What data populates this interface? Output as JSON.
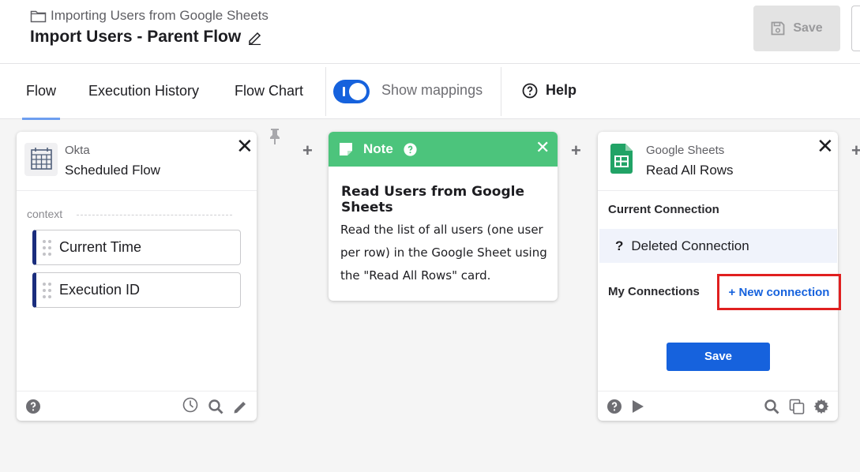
{
  "header": {
    "breadcrumb": "Importing Users from Google Sheets",
    "title": "Import Users - Parent Flow",
    "save_label": "Save"
  },
  "tabs": {
    "flow": "Flow",
    "history": "Execution History",
    "chart": "Flow Chart",
    "show_mappings": "Show mappings",
    "help": "Help"
  },
  "okta_card": {
    "app": "Okta",
    "name": "Scheduled Flow",
    "context_label": "context",
    "fields": [
      "Current Time",
      "Execution ID"
    ]
  },
  "note_card": {
    "header": "Note",
    "title": "Read Users from Google Sheets",
    "body": "Read the list of all users (one user per row) in the Google Sheet using the \"Read All Rows\" card."
  },
  "sheets_card": {
    "app": "Google Sheets",
    "name": "Read All Rows",
    "current_connection_label": "Current Connection",
    "deleted_connection": "Deleted Connection",
    "my_connections_label": "My Connections",
    "new_connection": "+ New connection",
    "save_label": "Save"
  },
  "colors": {
    "accent": "#1662dd",
    "note_green": "#4cc47c",
    "highlight_red": "#e02020",
    "sheets_green": "#21a366"
  }
}
